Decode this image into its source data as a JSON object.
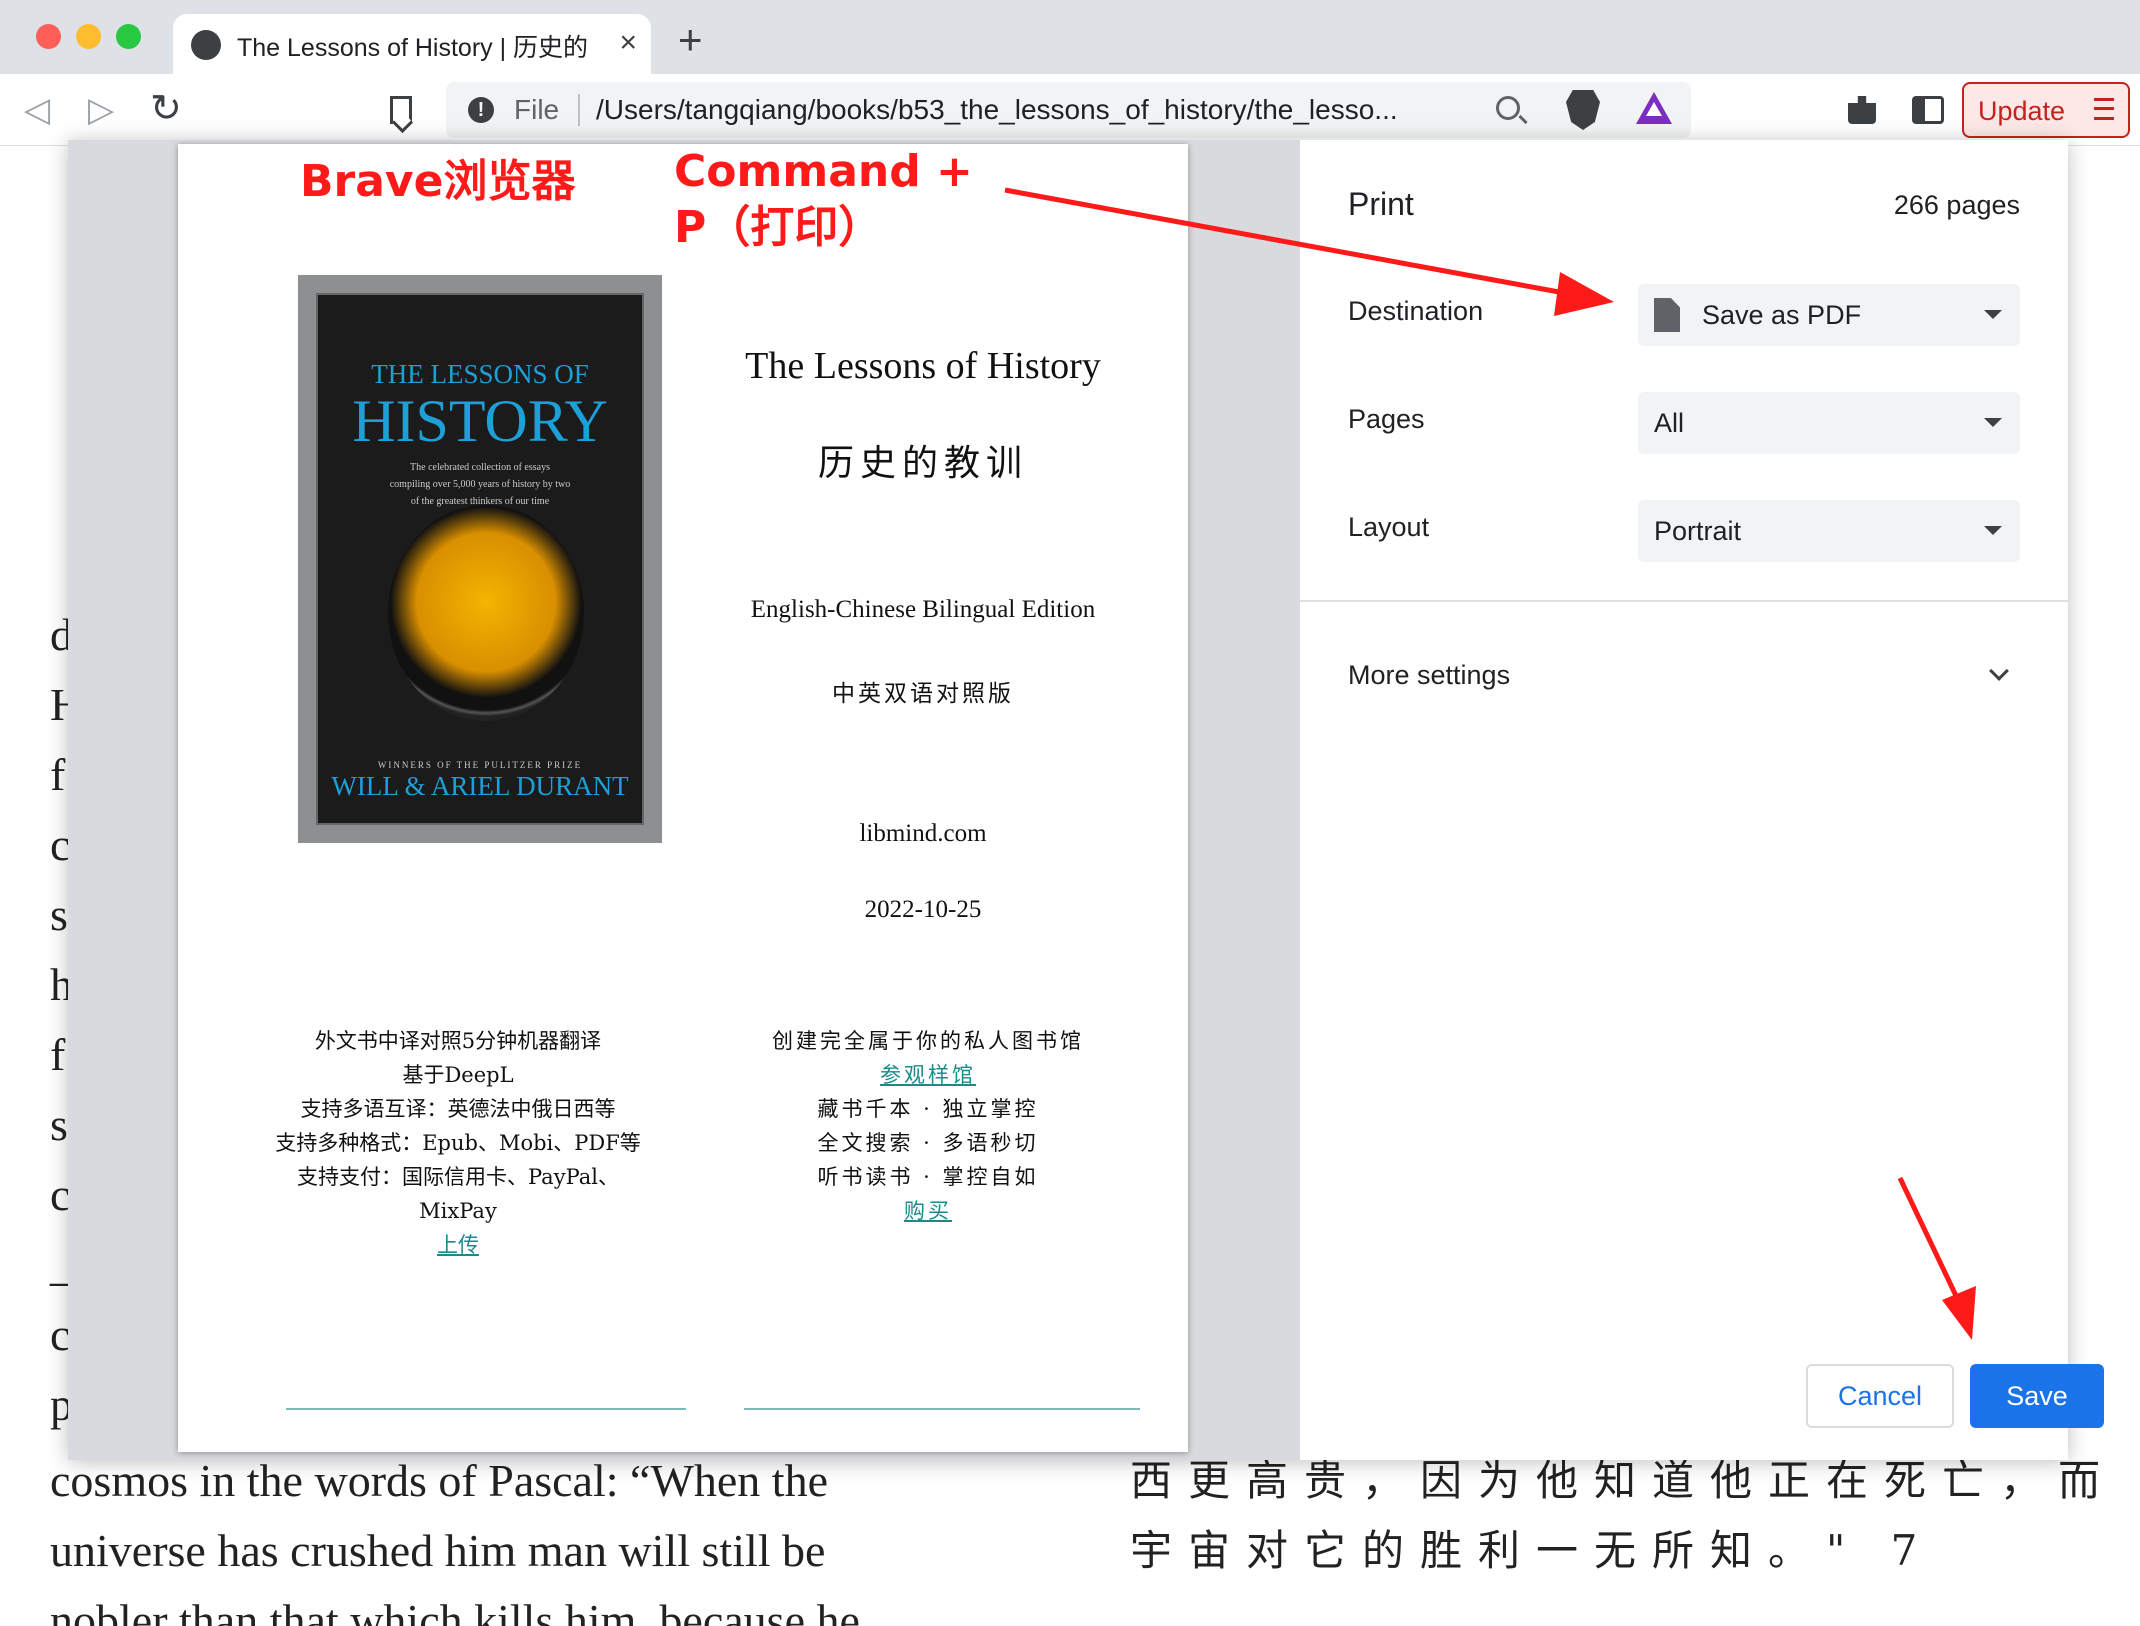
{
  "browser": {
    "tab_title": "The Lessons of History | 历史的教训",
    "tab_close": "×",
    "new_tab": "+",
    "back": "◁",
    "forward": "▷",
    "reload": "↻",
    "scheme": "File",
    "url": "/Users/tangqiang/books/b53_the_lessons_of_history/the_lesso...",
    "update_label": "Update",
    "colors": {
      "close": "#ff5f57",
      "minimize": "#febc2e",
      "zoom": "#28c840"
    }
  },
  "background": {
    "left_letters": [
      "d",
      "H",
      "f",
      "c",
      "s",
      "h",
      "f",
      "s",
      "c",
      "_",
      "c",
      "p"
    ],
    "english_lines": [
      "cosmos in the words of Pascal: “When the",
      "universe has crushed him man will still be",
      "nobler than that which kills him, because he"
    ],
    "chinese_lines": [
      "西更高贵，因为他知道他正在死亡，而",
      "宇宙对它的胜利一无所知。\" 7"
    ]
  },
  "annotations": {
    "browser_label": "Brave浏览器",
    "shortcut_line1": "Command +",
    "shortcut_line2": "P（打印）"
  },
  "preview": {
    "cover": {
      "title_top": "THE LESSONS OF",
      "title_main": "HISTORY",
      "blurb": [
        "The celebrated collection of essays",
        "compiling over 5,000 years of history by two",
        "of the greatest thinkers of our time"
      ],
      "prize": "WINNERS OF THE PULITZER PRIZE",
      "authors": "WILL & ARIEL DURANT"
    },
    "title_en": "The Lessons of History",
    "title_zh": "历史的教训",
    "edition_en": "English-Chinese Bilingual Edition",
    "edition_zh": "中英双语对照版",
    "site": "libmind.com",
    "date": "2022-10-25",
    "left_block": [
      "外文书中译对照5分钟机器翻译",
      "基于DeepL",
      "支持多语互译：英德法中俄日西等",
      "支持多种格式：Epub、Mobi、PDF等",
      "支持支付：国际信用卡、PayPal、",
      "MixPay"
    ],
    "left_link": "上传",
    "right_block_top": "创建完全属于你的私人图书馆",
    "right_link_top": "参观样馆",
    "right_block": [
      "藏书千本 · 独立掌控",
      "全文搜索 · 多语秒切",
      "听书读书 · 掌控自如"
    ],
    "right_link_bottom": "购买"
  },
  "print": {
    "title": "Print",
    "page_count": "266 pages",
    "destination_label": "Destination",
    "destination_value": "Save as PDF",
    "pages_label": "Pages",
    "pages_value": "All",
    "layout_label": "Layout",
    "layout_value": "Portrait",
    "more_settings": "More settings",
    "cancel": "Cancel",
    "save": "Save",
    "accent": "#1a73e8"
  }
}
